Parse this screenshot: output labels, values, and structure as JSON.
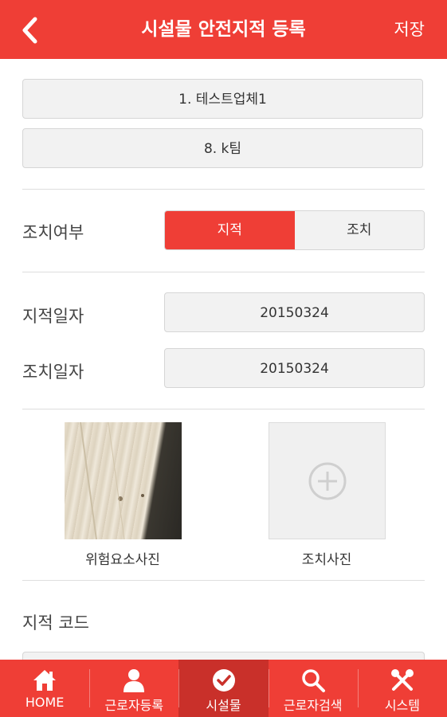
{
  "header": {
    "title": "시설물 안전지적 등록",
    "save_label": "저장",
    "back_icon": "chevron-left-icon"
  },
  "company_field": {
    "value": "1. 테스트업체1"
  },
  "team_field": {
    "value": "8. k팀"
  },
  "action_status": {
    "label": "조치여부",
    "options": [
      "지적",
      "조치"
    ],
    "selected": "지적"
  },
  "dates": {
    "pointed_label": "지적일자",
    "pointed_value": "20150324",
    "action_label": "조치일자",
    "action_value": "20150324"
  },
  "photos": {
    "hazard_caption": "위험요소사진",
    "action_caption": "조치사진"
  },
  "code_label": "지적 코드",
  "tabbar": {
    "items": [
      {
        "label": "HOME",
        "icon": "home-icon"
      },
      {
        "label": "근로자등록",
        "icon": "person-icon"
      },
      {
        "label": "시설물",
        "icon": "check-circle-icon"
      },
      {
        "label": "근로자검색",
        "icon": "search-icon"
      },
      {
        "label": "시스템",
        "icon": "tools-icon"
      }
    ],
    "active": "시설물"
  },
  "colors": {
    "brand": "#ef3e36",
    "active_tab": "#c9302a",
    "field_bg": "#f2f2f2"
  }
}
